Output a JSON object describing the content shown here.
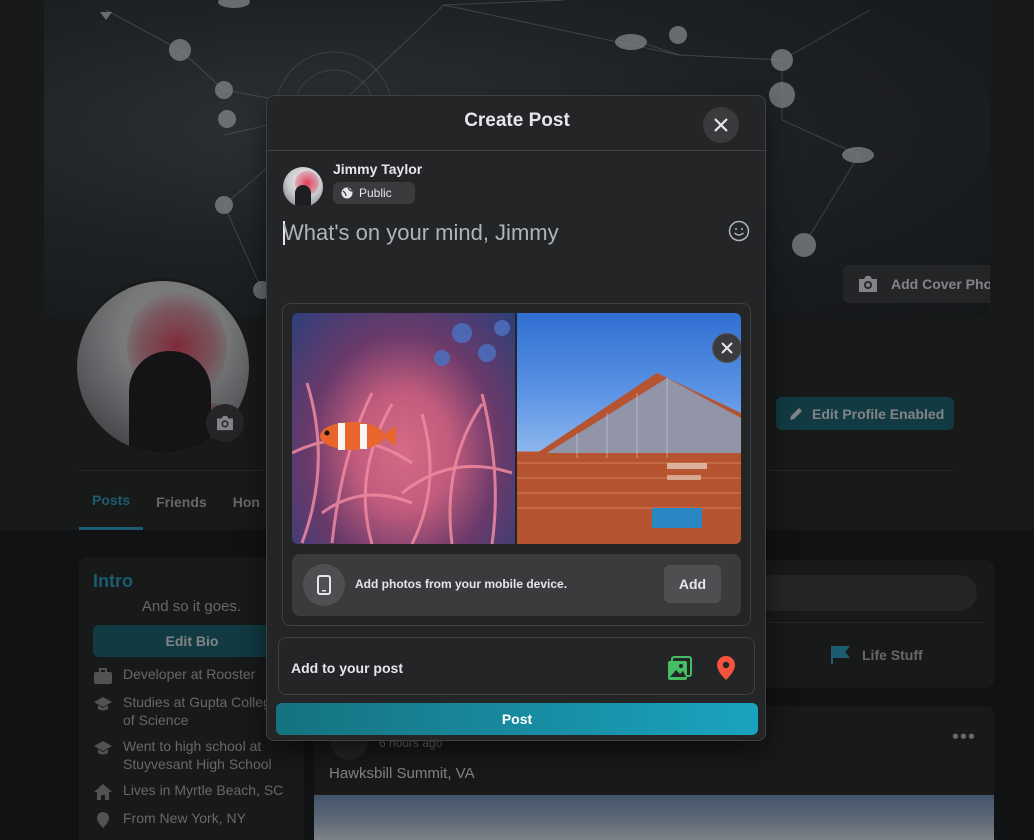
{
  "cover": {
    "add_cover_label": "Add Cover Photo"
  },
  "profile": {
    "edit_profile_label": "Edit Profile Enabled"
  },
  "tabs": [
    {
      "label": "Posts"
    },
    {
      "label": "Friends"
    },
    {
      "label": "Hon"
    }
  ],
  "intro": {
    "title": "Intro",
    "bio": "And so it goes.",
    "edit_bio_label": "Edit Bio",
    "items": [
      {
        "icon": "briefcase-icon",
        "text": "Developer at Rooster"
      },
      {
        "icon": "graduation-cap-icon",
        "text": "Studies at Gupta College of Science"
      },
      {
        "icon": "graduation-cap-icon",
        "text": "Went to high school at Stuyvesant High School"
      },
      {
        "icon": "home-icon",
        "text": "Lives in Myrtle Beach, SC"
      },
      {
        "icon": "location-icon",
        "text": "From New York, NY"
      }
    ]
  },
  "composer_card": {
    "life_label": "Life Stuff"
  },
  "feed": {
    "time": "6 hours ago",
    "location": "Hawksbill Summit, VA"
  },
  "modal": {
    "title": "Create Post",
    "user_name": "Jimmy Taylor",
    "privacy": "Public",
    "placeholder": "What's on your mind, Jimmy",
    "mobile_text": "Add photos from your mobile device.",
    "mobile_add": "Add",
    "add_to_post": "Add to your post",
    "post_label": "Post",
    "accent_colors": {
      "photo": "#45bd62",
      "location": "#f5533d",
      "post_start": "#16727f",
      "post_end": "#1aa3c0"
    }
  }
}
